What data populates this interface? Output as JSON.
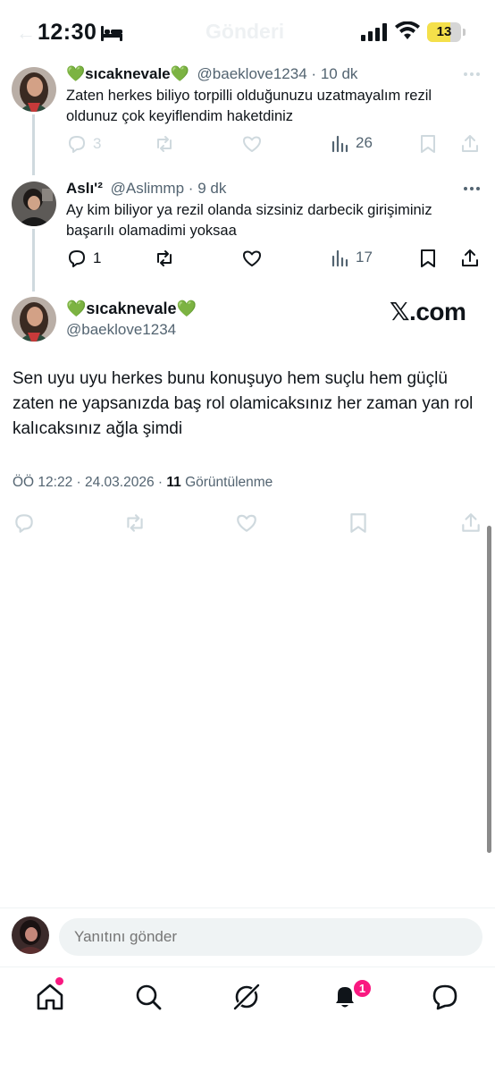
{
  "status_bar": {
    "time": "12:30",
    "battery": "13"
  },
  "header": {
    "title": "Gönderi"
  },
  "replies": [
    {
      "display_name": "💚sıcaknevale💚",
      "handle": "@baeklove1234",
      "time": "10 dk",
      "text": "Zaten herkes biliyo torpilli olduğunuzu uzatmayalım rezil oldunuz çok keyiflendim haketdiniz",
      "replies_count": "3",
      "views_count": "26"
    },
    {
      "display_name": "Aslı'²",
      "handle": "@Aslimmp",
      "time": "9 dk",
      "text": "Ay kim biliyor ya rezil olanda sizsiniz darbecik girişiminiz başarılı olamadimi yoksaa",
      "replies_count": "1",
      "views_count": "17"
    }
  ],
  "main_tweet": {
    "display_name": "💚sıcaknevale💚",
    "handle": "@baeklove1234",
    "watermark": "𝕏.com",
    "text": "Sen uyu uyu herkes bunu konuşuyo hem suçlu hem güçlü zaten ne yapsanızda baş rol olamicaksınız her zaman yan rol kalıcaksınız ağla şimdi",
    "time": "ÖÖ 12:22",
    "date": "24.03.2026",
    "views_count": "11",
    "views_label": "Görüntülenme"
  },
  "composer": {
    "placeholder": "Yanıtını gönder"
  },
  "nav": {
    "notifications_badge": "1"
  },
  "colors": {
    "accent": "#1d9bf0",
    "pink": "#f91880",
    "muted": "#536471",
    "border": "#cfd9de"
  }
}
